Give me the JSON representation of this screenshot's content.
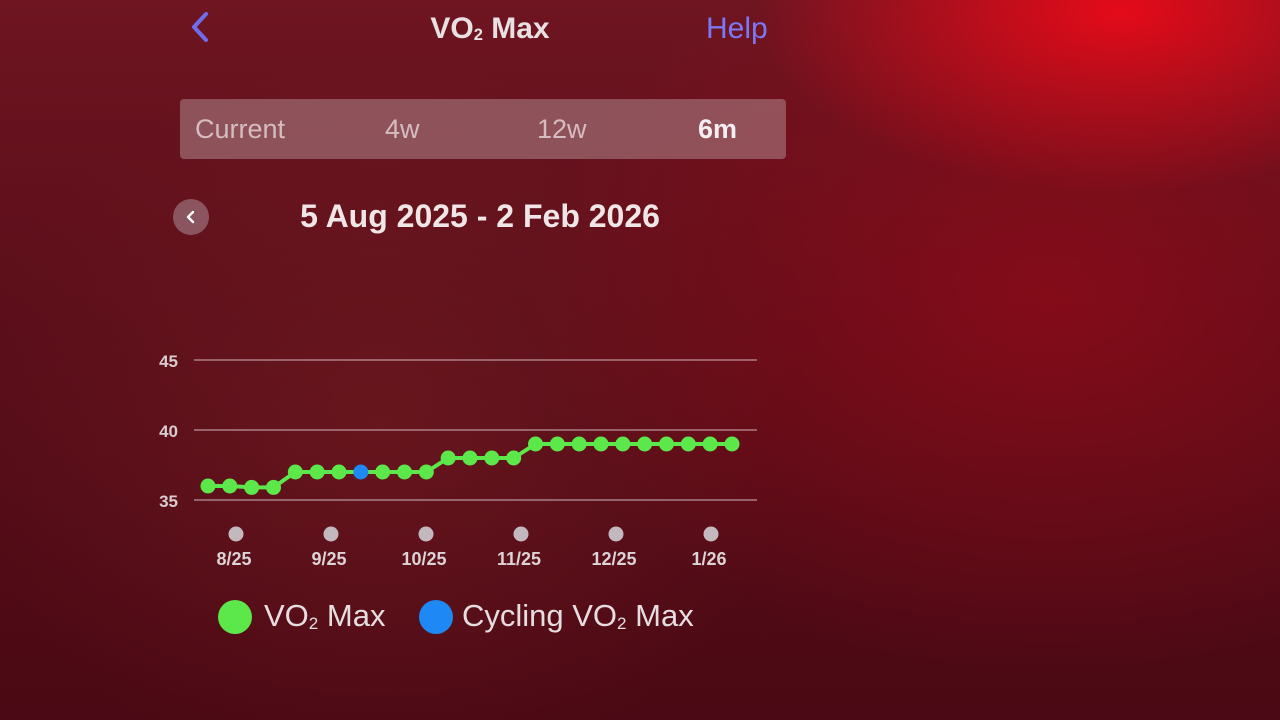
{
  "header": {
    "title_main": "VO",
    "title_sub": "2",
    "title_rest": " Max",
    "help_label": "Help"
  },
  "segments": [
    {
      "label": "Current",
      "active": false
    },
    {
      "label": "4w",
      "active": false
    },
    {
      "label": "12w",
      "active": false
    },
    {
      "label": "6m",
      "active": true
    }
  ],
  "date_range": {
    "label": "5 Aug 2025 - 2 Feb 2026"
  },
  "legend": [
    {
      "main": "VO",
      "sub": "2",
      "rest": " Max",
      "color": "#5ce84a"
    },
    {
      "main": "Cycling VO",
      "sub": "2",
      "rest": " Max",
      "color": "#1e88f5"
    }
  ],
  "colors": {
    "accent": "#7a78f5",
    "vo2_series": "#5ce84a",
    "cycling_series": "#1e88f5"
  },
  "chart_data": {
    "type": "line",
    "ylim": [
      35,
      45
    ],
    "yticks": [
      "35",
      "40",
      "45"
    ],
    "xticks": [
      "8/25",
      "9/25",
      "10/25",
      "11/25",
      "12/25",
      "1/26"
    ],
    "grid": true,
    "series": [
      {
        "name": "VO₂ Max",
        "color": "#5ce84a",
        "values": [
          36.0,
          36.0,
          35.9,
          35.9,
          37.0,
          37.0,
          37.0,
          37.0,
          37.0,
          37.0,
          37.0,
          38.0,
          38.0,
          38.0,
          38.0,
          39.0,
          39.0,
          39.0,
          39.0,
          39.0,
          39.0,
          39.0,
          39.0,
          39.0,
          39.0
        ]
      },
      {
        "name": "Cycling VO₂ Max",
        "color": "#1e88f5",
        "points": [
          {
            "index": 7,
            "value": 37.0
          }
        ]
      }
    ]
  }
}
